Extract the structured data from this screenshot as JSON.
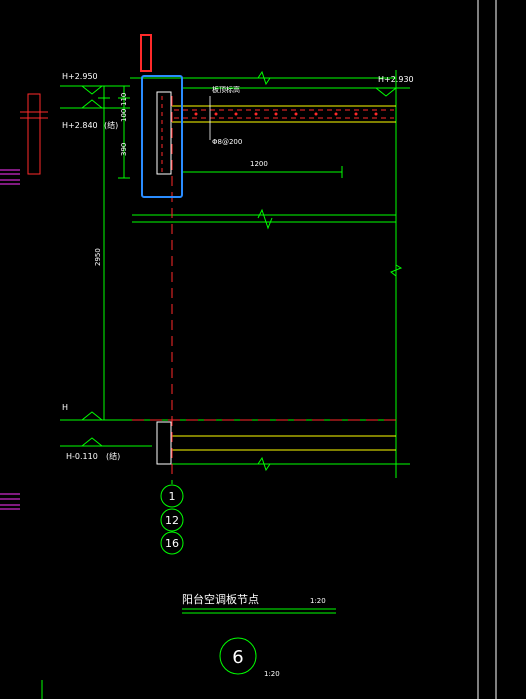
{
  "drawing": {
    "elevations": {
      "top_left_1": "H+2.950",
      "top_left_2": "H+2.840",
      "top_left_2_note": "(结)",
      "top_right": "H+2.930",
      "bottom_left_1": "H",
      "bottom_left_2": "H-0.110",
      "bottom_left_2_note": "(结)"
    },
    "dimensions": {
      "d_100": "100",
      "d_110": "110",
      "d_390": "390",
      "d_1200": "1200",
      "d_2950": "2950"
    },
    "callouts": {
      "slab_label": "板顶标高",
      "rebar_label": "Φ8@200"
    },
    "axis_numbers": [
      "1",
      "12",
      "16"
    ],
    "title": {
      "text": "阳台空调板节点",
      "scale": "1:20"
    },
    "detail_marker": {
      "number": "6",
      "scale": "1:20"
    },
    "colors": {
      "background": "#000000",
      "structure_line": "#00ff00",
      "concrete_line": "#ffff00",
      "axis_dash": "#ff0000",
      "highlight_red": "#ff2a2a",
      "highlight_blue": "#2a8cff",
      "magenta": "#ff33ff"
    }
  }
}
